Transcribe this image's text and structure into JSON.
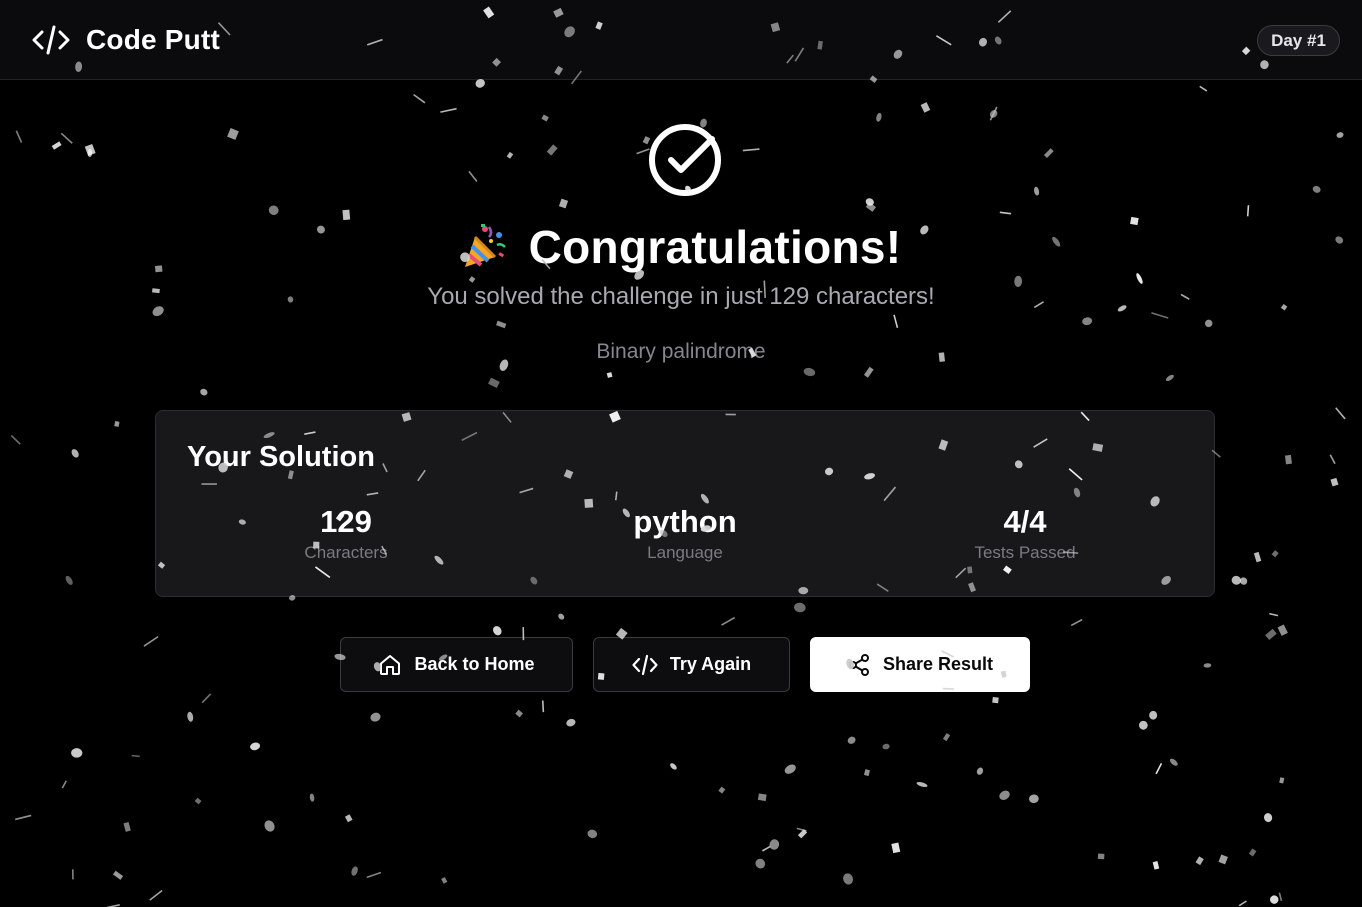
{
  "header": {
    "app_name": "Code Putt",
    "day_badge": "Day #1"
  },
  "result": {
    "title": "Congratulations!",
    "subtitle": "You solved the challenge in just 129 characters!",
    "problem_name": "Binary palindrome"
  },
  "solution_card": {
    "title": "Your Solution",
    "stats": [
      {
        "value": "129",
        "label": "Characters"
      },
      {
        "value": "python",
        "label": "Language"
      },
      {
        "value": "4/4",
        "label": "Tests Passed"
      }
    ]
  },
  "actions": {
    "back_home": "Back to Home",
    "try_again": "Try Again",
    "share": "Share Result"
  },
  "icons": {
    "brand": "code-icon",
    "success": "check-circle-icon",
    "celebration": "party-popper-icon",
    "home": "home-icon",
    "try_again": "code-icon",
    "share": "share-icon"
  },
  "colors": {
    "background": "#000000",
    "header": "#0b0b0d",
    "card": "#18181b",
    "muted_text": "#a9a9b2",
    "primary_button": "#ffffff"
  }
}
